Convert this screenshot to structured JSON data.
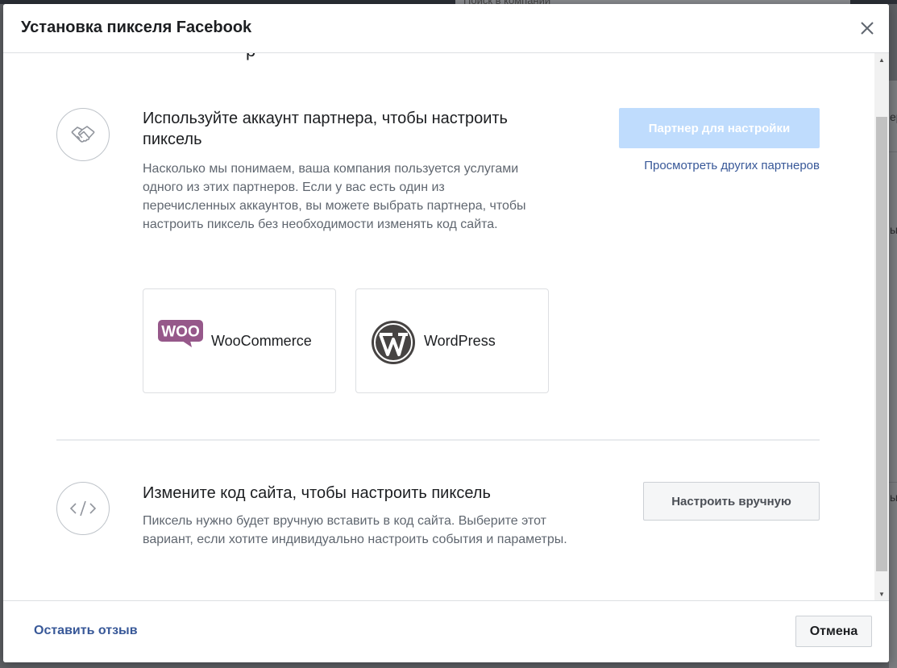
{
  "background": {
    "search_placeholder": "Поиск в компании",
    "side_labels": [
      "ер",
      "ы",
      "ы"
    ]
  },
  "modal": {
    "title": "Установка пикселя Facebook",
    "close_icon": "close-icon",
    "cut_heading_fragment": "р"
  },
  "partner_section": {
    "icon": "handshake-icon",
    "title": "Используйте аккаунт партнера, чтобы настроить пиксель",
    "description": "Насколько мы понимаем, ваша компания пользуется услугами одного из этих партнеров. Если у вас есть один из перечисленных аккаунтов, вы можете выбрать партнера, чтобы настроить пиксель без необходимости изменять код сайта.",
    "primary_button": "Партнер для настройки",
    "secondary_link": "Просмотреть других партнеров",
    "partners": [
      {
        "name": "WooCommerce",
        "logo": "woocommerce-logo",
        "logo_text": "WOO",
        "logo_color": "#96588a"
      },
      {
        "name": "WordPress",
        "logo": "wordpress-logo",
        "logo_color": "#464342"
      }
    ]
  },
  "manual_section": {
    "icon": "code-icon",
    "title": "Измените код сайта, чтобы настроить пиксель",
    "description": "Пиксель нужно будет вручную вставить в код сайта. Выберите этот вариант, если хотите индивидуально настроить события и параметры.",
    "button": "Настроить вручную"
  },
  "footer": {
    "feedback_link": "Оставить отзыв",
    "cancel_button": "Отмена"
  },
  "colors": {
    "link": "#385898",
    "primary_disabled": "#bfdcfd",
    "muted_text": "#606770"
  }
}
